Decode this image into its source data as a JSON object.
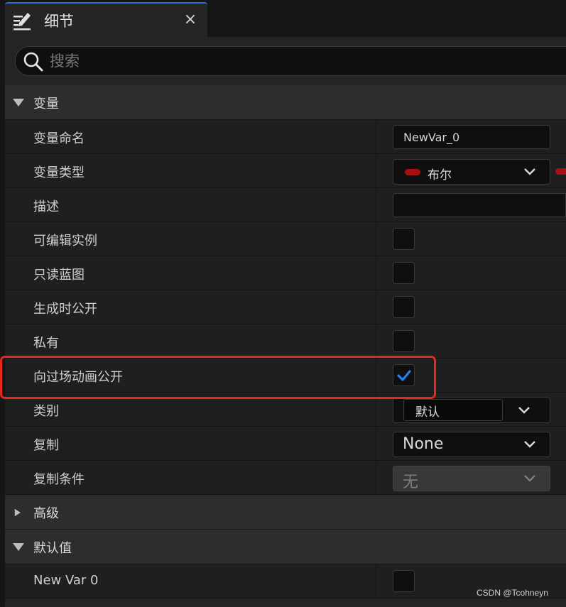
{
  "tab": {
    "title": "细节",
    "close_glyph": "×",
    "icon": "edit-icon"
  },
  "search": {
    "placeholder": "搜索",
    "value": ""
  },
  "sections": {
    "variable": {
      "label": "变量",
      "expanded": true
    },
    "advanced": {
      "label": "高级",
      "expanded": false
    },
    "default_value": {
      "label": "默认值",
      "expanded": true
    }
  },
  "properties": {
    "var_name": {
      "label": "变量命名",
      "value": "NewVar_0"
    },
    "var_type": {
      "label": "变量类型",
      "value": "布尔",
      "pin_color": "#a80f10"
    },
    "description": {
      "label": "描述",
      "value": ""
    },
    "instance_editable": {
      "label": "可编辑实例",
      "checked": false
    },
    "blueprint_read_only": {
      "label": "只读蓝图",
      "checked": false
    },
    "expose_on_spawn": {
      "label": "生成时公开",
      "checked": false
    },
    "private": {
      "label": "私有",
      "checked": false
    },
    "expose_to_cinematics": {
      "label": "向过场动画公开",
      "checked": true
    },
    "category": {
      "label": "类别",
      "value": "默认"
    },
    "replication": {
      "label": "复制",
      "value": "None"
    },
    "replication_condition": {
      "label": "复制条件",
      "value": "无"
    },
    "new_var_0": {
      "label": "New Var 0",
      "checked": false
    }
  },
  "colors": {
    "accent": "#2f6fd6",
    "highlight": "#e8271f",
    "check": "#2b7de9"
  },
  "watermark": "CSDN @Tcohneyn"
}
